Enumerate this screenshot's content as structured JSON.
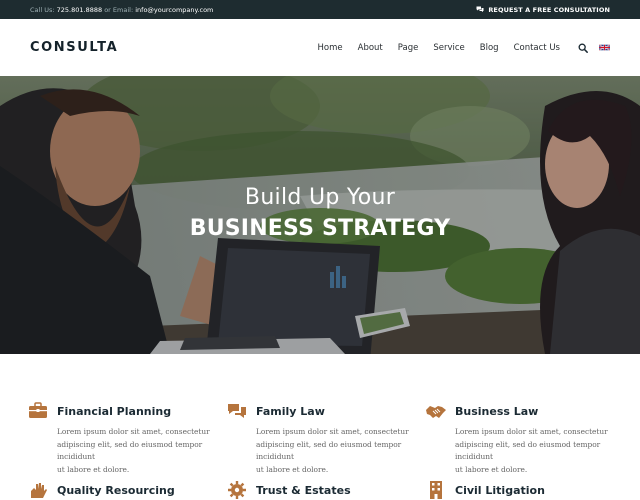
{
  "topbar": {
    "call_label": "Call Us:",
    "phone": "725.801.8888",
    "email_label": "or Email:",
    "email": "info@yourcompany.com",
    "cta_label": "REQUEST A FREE CONSULTATION",
    "cta_icon": "chat-bubbles-icon"
  },
  "header": {
    "logo_text": "CONSULTA",
    "nav": [
      {
        "label": "Home"
      },
      {
        "label": "About"
      },
      {
        "label": "Page"
      },
      {
        "label": "Service"
      },
      {
        "label": "Blog"
      },
      {
        "label": "Contact Us"
      }
    ],
    "search_icon": "search-icon",
    "language_icon": "uk-flag-icon"
  },
  "hero": {
    "title_line1": "Build Up Your",
    "title_line2": "BUSINESS STRATEGY"
  },
  "colors": {
    "topbar_bg": "#1e2c30",
    "accent": "#b5743d",
    "heading": "#1b2a33"
  },
  "services": [
    {
      "title": "Financial Planning",
      "icon": "briefcase-icon",
      "desc": [
        "Lorem ipsum dolor sit amet, consectetur",
        "adipiscing elit, sed do eiusmod tempor incididunt",
        "ut labore et dolore."
      ]
    },
    {
      "title": "Family Law",
      "icon": "chat-bubbles-icon",
      "desc": [
        "Lorem ipsum dolor sit amet, consectetur",
        "adipiscing elit, sed do eiusmod tempor incididunt",
        "ut labore et dolore."
      ]
    },
    {
      "title": "Business Law",
      "icon": "handshake-icon",
      "desc": [
        "Lorem ipsum dolor sit amet, consectetur",
        "adipiscing elit, sed do eiusmod tempor incididunt",
        "ut labore et dolore."
      ]
    },
    {
      "title": "Quality Resourcing",
      "icon": "hand-icon",
      "desc": []
    },
    {
      "title": "Trust & Estates",
      "icon": "gear-icon",
      "desc": []
    },
    {
      "title": "Civil Litigation",
      "icon": "building-icon",
      "desc": []
    }
  ]
}
